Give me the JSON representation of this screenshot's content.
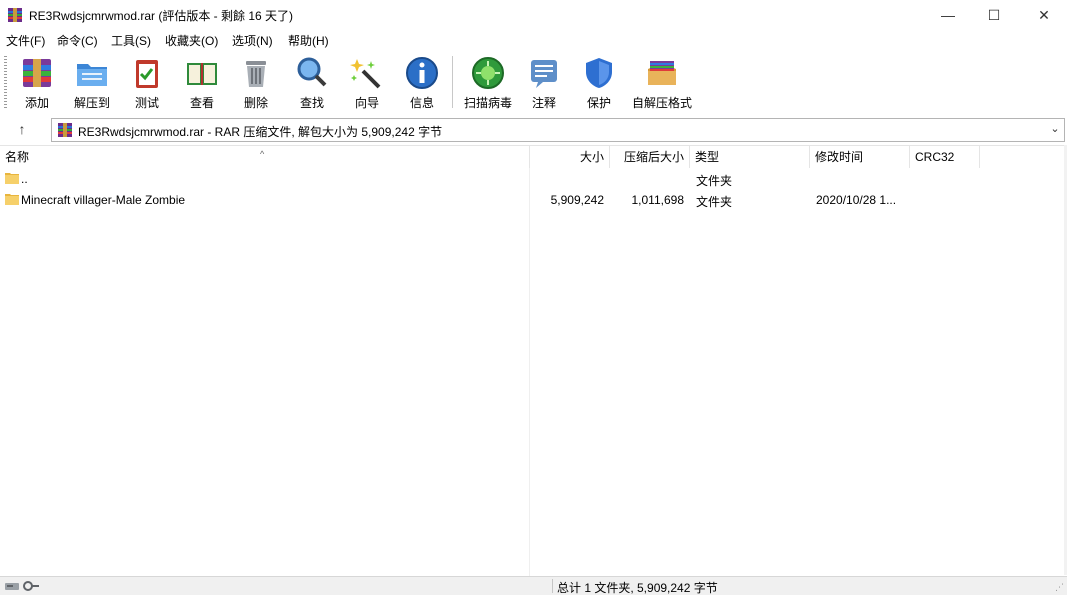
{
  "window": {
    "title": "RE3Rwdsjcmrwmod.rar (評估版本 - 剩餘 16 天了)",
    "controls": {
      "minimize": "—",
      "maximize": "☐",
      "close": "✕"
    }
  },
  "menu": {
    "file": "文件(F)",
    "commands": "命令(C)",
    "tools": "工具(S)",
    "favorites": "收藏夹(O)",
    "options": "选项(N)",
    "help": "帮助(H)"
  },
  "toolbar": {
    "add": "添加",
    "extract_to": "解压到",
    "test": "测试",
    "view": "查看",
    "delete": "删除",
    "find": "查找",
    "wizard": "向导",
    "info": "信息",
    "scan": "扫描病毒",
    "comment": "注释",
    "protect": "保护",
    "sfx": "自解压格式"
  },
  "address": {
    "path": "RE3Rwdsjcmrwmod.rar - RAR 压缩文件, 解包大小为 5,909,242 字节"
  },
  "columns": {
    "name": "名称",
    "size": "大小",
    "packed": "压缩后大小",
    "type": "类型",
    "modified": "修改时间",
    "crc": "CRC32"
  },
  "rows": [
    {
      "name": "..",
      "size": "",
      "packed": "",
      "type": "文件夹",
      "modified": ""
    },
    {
      "name": "Minecraft villager-Male Zombie",
      "size": "5,909,242",
      "packed": "1,011,698",
      "type": "文件夹",
      "modified": "2020/10/28 1..."
    }
  ],
  "status": {
    "summary": "总计 1 文件夹, 5,909,242 字节"
  },
  "icons": {
    "app": "winrar-icon",
    "folder": "folder-icon",
    "up": "up-arrow-icon"
  },
  "colors": {
    "folder": "#f3c74f",
    "selection": "#ffffff",
    "status_bg": "#f0f0f0"
  }
}
